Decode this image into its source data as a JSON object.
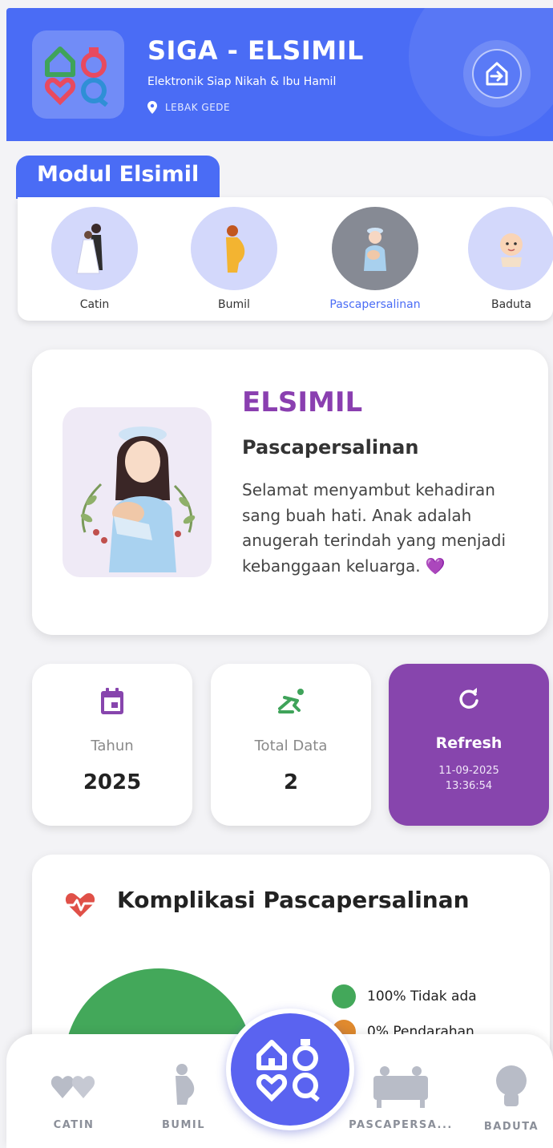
{
  "header": {
    "title": "SIGA - ELSIMIL",
    "subtitle": "Elektronik Siap Nikah & Ibu Hamil",
    "location": "LEBAK GEDE",
    "accent": "#4a6cf5"
  },
  "modul": {
    "tab_label": "Modul Elsimil",
    "items": [
      {
        "label": "Catin",
        "icon": "wedding-couple-icon",
        "active": false
      },
      {
        "label": "Bumil",
        "icon": "pregnant-woman-icon",
        "active": false
      },
      {
        "label": "Pascapersalinan",
        "icon": "mother-baby-icon",
        "active": true
      },
      {
        "label": "Baduta",
        "icon": "baby-face-icon",
        "active": false
      }
    ]
  },
  "hero": {
    "title": "ELSIMIL",
    "subtitle": "Pascapersalinan",
    "description": "Selamat menyambut kehadiran sang buah hati. Anak adalah anugerah terindah yang menjadi kebanggaan keluarga. 💜"
  },
  "stats": {
    "year_label": "Tahun",
    "year_value": "2025",
    "total_label": "Total Data",
    "total_value": "2",
    "refresh_label": "Refresh",
    "refresh_date": "11-09-2025",
    "refresh_time": "13:36:54"
  },
  "komplikasi": {
    "title": "Komplikasi Pascapersalinan",
    "legend": [
      {
        "label": "100% Tidak ada",
        "color": "#43a85a"
      },
      {
        "label": "0% Pendarahan",
        "color": "#e08a2e"
      }
    ]
  },
  "chart_data": {
    "type": "pie",
    "categories": [
      "Tidak ada",
      "Pendarahan"
    ],
    "values": [
      100,
      0
    ],
    "colors": [
      "#43a85a",
      "#e08a2e"
    ],
    "title": "Komplikasi Pascapersalinan"
  },
  "bottom_nav": {
    "items": [
      {
        "label": "CATIN",
        "icon": "couple-hearts-icon"
      },
      {
        "label": "BUMIL",
        "icon": "pregnant-silhouette-icon"
      },
      {
        "label": "PASCAPERSA...",
        "icon": "family-scene-icon"
      },
      {
        "label": "BADUTA",
        "icon": "child-head-icon"
      }
    ],
    "center_icon": "siga-logo-icon"
  }
}
